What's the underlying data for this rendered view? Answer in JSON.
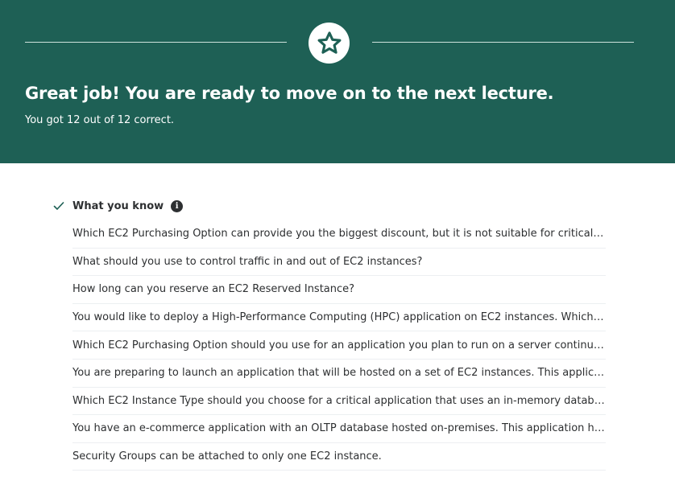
{
  "colors": {
    "banner": "#1e6055",
    "accent_check": "#1e6055"
  },
  "banner": {
    "icon": "star-icon",
    "headline": "Great job! You are ready to move on to the next lecture.",
    "score_text": "You got 12 out of 12 correct."
  },
  "section": {
    "title": "What you know",
    "check_icon": "check-icon",
    "info_icon": "info-icon",
    "info_glyph": "i"
  },
  "questions": [
    "Which EC2 Purchasing Option can provide you the biggest discount, but it is not suitable for critical j…",
    "What should you use to control traffic in and out of EC2 instances?",
    "How long can you reserve an EC2 Reserved Instance?",
    "You would like to deploy a High-Performance Computing (HPC) application on EC2 instances. Which …",
    "Which EC2 Purchasing Option should you use for an application you plan to run on a server continuou…",
    "You are preparing to launch an application that will be hosted on a set of EC2 instances. This applicati…",
    "Which EC2 Instance Type should you choose for a critical application that uses an in-memory databas…",
    "You have an e-commerce application with an OLTP database hosted on-premises. This application ha…",
    "Security Groups can be attached to only one EC2 instance."
  ]
}
